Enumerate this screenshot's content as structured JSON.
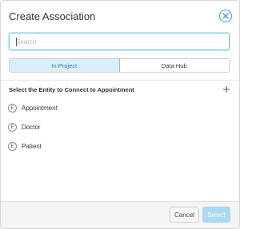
{
  "dialog": {
    "title": "Create Association",
    "close_icon": "close-circle-icon"
  },
  "search": {
    "placeholder": "Search",
    "value": ""
  },
  "tabs": [
    {
      "label": "In Project",
      "active": true
    },
    {
      "label": "Data Hub",
      "active": false
    }
  ],
  "section": {
    "title": "Select the Entity to Connect to Appointment",
    "add_icon": "plus-icon"
  },
  "entities": [
    {
      "badge": "E",
      "label": "Appointment"
    },
    {
      "badge": "E",
      "label": "Doctor"
    },
    {
      "badge": "E",
      "label": "Patient"
    }
  ],
  "footer": {
    "cancel_label": "Cancel",
    "select_label": "Select",
    "select_enabled": false
  },
  "colors": {
    "accent": "#2aa3e0",
    "tab_active_bg": "#d9eefa",
    "select_disabled_bg": "#a9d9f4"
  }
}
